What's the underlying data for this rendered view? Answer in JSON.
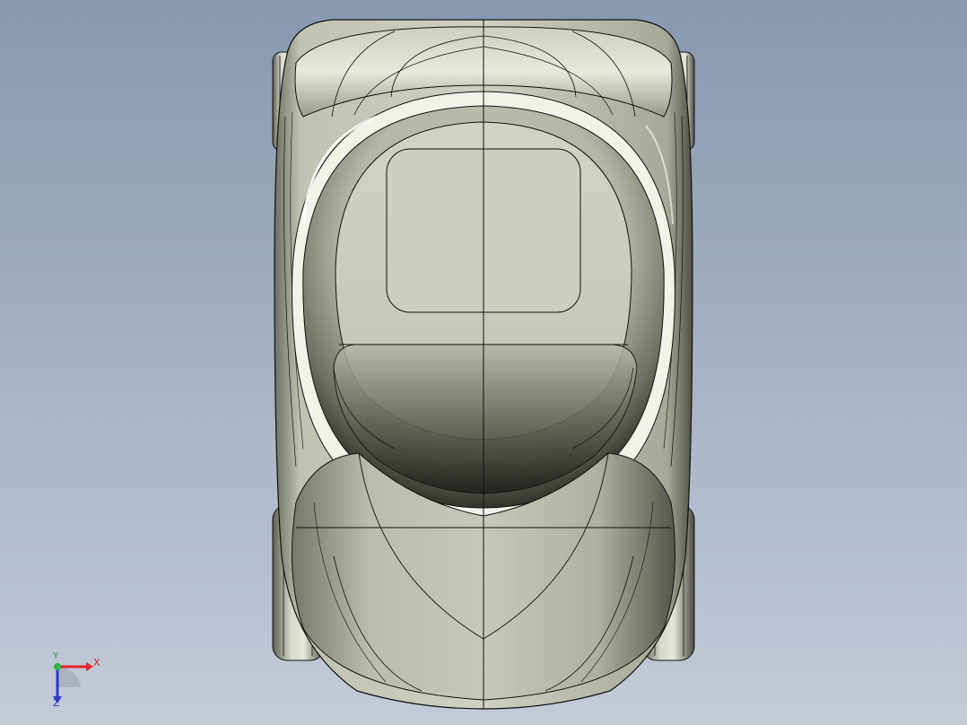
{
  "viewport": {
    "background_top": "#8798b0",
    "background_bottom": "#c4cbd8"
  },
  "model": {
    "name": "vehicle-top-view",
    "body_color": "#c9c9bb",
    "shadow_color": "#2b2b27",
    "edge_color": "#111111"
  },
  "triad": {
    "x_label": "X",
    "y_label": "Y",
    "z_label": "Z",
    "x_color": "#e0262a",
    "y_color": "#2eb84a",
    "z_color": "#2a3ac8"
  }
}
